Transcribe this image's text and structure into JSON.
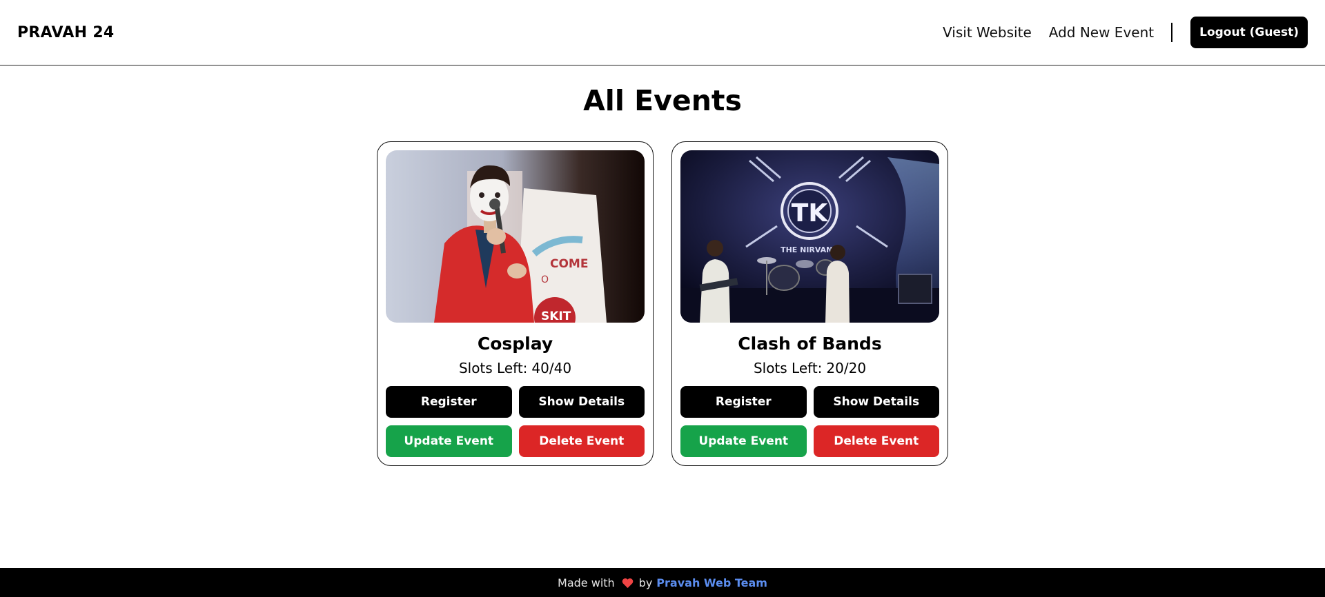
{
  "header": {
    "brand": "PRAVAH 24",
    "nav_links": [
      "Visit Website",
      "Add New Event"
    ],
    "logout_label": "Logout (Guest)"
  },
  "main": {
    "title": "All Events",
    "events": [
      {
        "name": "Cosplay",
        "slots_label": "Slots Left:",
        "slots": "40/40",
        "image_icon": "cosplay-photo",
        "register_label": "Register",
        "details_label": "Show Details",
        "update_label": "Update Event",
        "delete_label": "Delete Event"
      },
      {
        "name": "Clash of Bands",
        "slots_label": "Slots Left:",
        "slots": "20/20",
        "image_icon": "band-stage-photo",
        "image_logo_text": "TK",
        "image_banner_text": "THE NIRVANA",
        "register_label": "Register",
        "details_label": "Show Details",
        "update_label": "Update Event",
        "delete_label": "Delete Event"
      }
    ]
  },
  "footer": {
    "prefix": "Made with",
    "heart_icon": "heart-icon",
    "by": "by",
    "link_text": "Pravah Web Team"
  },
  "colors": {
    "green": "#16a34a",
    "red": "#dc2626",
    "black": "#000000",
    "link": "#5b8def"
  }
}
